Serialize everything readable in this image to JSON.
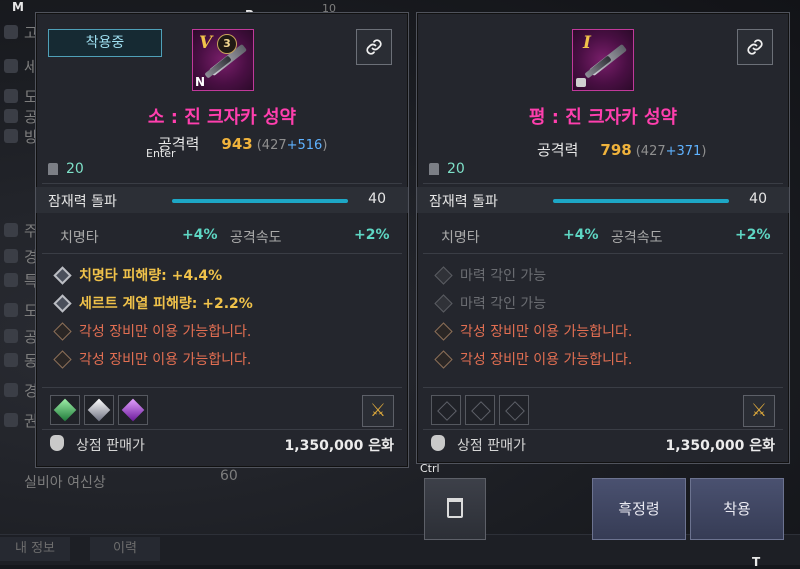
{
  "hints": {
    "m": "M",
    "r": "R",
    "enter": "Enter",
    "ctrl": "Ctrl",
    "t": "T"
  },
  "background": {
    "rows": [
      "고",
      "세",
      "도",
      "공",
      "방",
      "주요",
      "경",
      "특",
      "도",
      "공",
      "동",
      "경",
      "권"
    ],
    "tab_counter": "10",
    "silvia": "실비아 여신상",
    "silvia_val": "60",
    "bottom_tabs": [
      "내 정보",
      "이력",
      ""
    ]
  },
  "panel_left": {
    "badge": "착용중",
    "tier": "V",
    "level": "3",
    "marker": "N",
    "name": "소 : 진 크자카 성약",
    "attack_label": "공격력",
    "attack_value": "943",
    "attack_base": "427",
    "attack_bonus": "+516",
    "weight": "20",
    "transcend_label": "잠재력 돌파",
    "transcend_value": "40",
    "transcend_fill": 1.0,
    "stat1_name": "치명타",
    "stat1_val": "+4%",
    "stat2_name": "공격속도",
    "stat2_val": "+2%",
    "options": [
      {
        "text": "치명타 피해량: +4.4%",
        "kind": "gold"
      },
      {
        "text": "세르트 계열 피해량: +2.2%",
        "kind": "gold"
      },
      {
        "text": "각성 장비만 이용 가능합니다.",
        "kind": "red"
      },
      {
        "text": "각성 장비만 이용 가능합니다.",
        "kind": "red"
      }
    ],
    "gems": [
      "green",
      "white",
      "purple"
    ],
    "price_label": "상점 판매가",
    "price": "1,350,000 은화"
  },
  "panel_right": {
    "tier": "I",
    "name": "평 : 진 크자카 성약",
    "attack_label": "공격력",
    "attack_value": "798",
    "attack_base": "427",
    "attack_bonus": "+371",
    "weight": "20",
    "transcend_label": "잠재력 돌파",
    "transcend_value": "40",
    "transcend_fill": 1.0,
    "stat1_name": "치명타",
    "stat1_val": "+4%",
    "stat2_name": "공격속도",
    "stat2_val": "+2%",
    "options": [
      {
        "text": "마력 각인 가능",
        "kind": "grey"
      },
      {
        "text": "마력 각인 가능",
        "kind": "grey"
      },
      {
        "text": "각성 장비만 이용 가능합니다.",
        "kind": "red"
      },
      {
        "text": "각성 장비만 이용 가능합니다.",
        "kind": "red"
      }
    ],
    "gems": [
      "empty",
      "empty",
      "empty"
    ],
    "price_label": "상점 판매가",
    "price": "1,350,000 은화"
  },
  "buttons": {
    "black_spirit": "흑정령",
    "equip": "착용"
  },
  "colors": {
    "item_name": "#ff3fae",
    "attack_value": "#f0b33c",
    "bonus": "#5fb2ff",
    "stat": "#5ed6c3",
    "option_gold": "#f0c24a",
    "option_red": "#e36f52",
    "bar": "#1da7c6"
  }
}
